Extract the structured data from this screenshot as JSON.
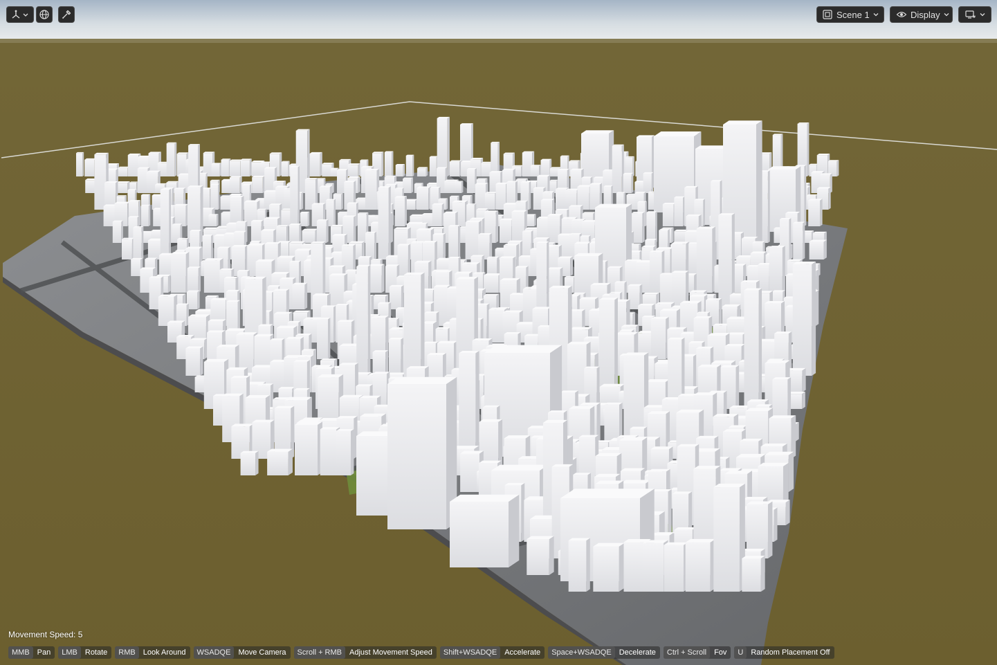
{
  "toolbar_left": {
    "transform_icon": "transform-gizmo-icon",
    "globe_icon": "globe-icon",
    "picker_icon": "eyedropper-icon"
  },
  "toolbar_right": {
    "scene_label": "Scene 1",
    "display_label": "Display",
    "camera_icon": "camera-view-icon"
  },
  "status": {
    "movement_speed": "Movement Speed: 5"
  },
  "shortcuts": [
    {
      "key": "MMB",
      "action": "Pan"
    },
    {
      "key": "LMB",
      "action": "Rotate"
    },
    {
      "key": "RMB",
      "action": "Look Around"
    },
    {
      "key": "WSADQE",
      "action": "Move Camera"
    },
    {
      "key": "Scroll + RMB",
      "action": "Adjust Movement Speed"
    },
    {
      "key": "Shift+WSADQE",
      "action": "Accelerate"
    },
    {
      "key": "Space+WSADQE",
      "action": "Decelerate"
    },
    {
      "key": "Ctrl + Scroll",
      "action": "Fov"
    },
    {
      "key": "U",
      "action": "Random Placement Off"
    }
  ],
  "colors": {
    "sky_top": "#a7b7c7",
    "horizon": "#e9ecec",
    "ground": "#6d6131",
    "building": "#efeff1",
    "road": "#5e6062",
    "grass": "#6e8a3a"
  }
}
